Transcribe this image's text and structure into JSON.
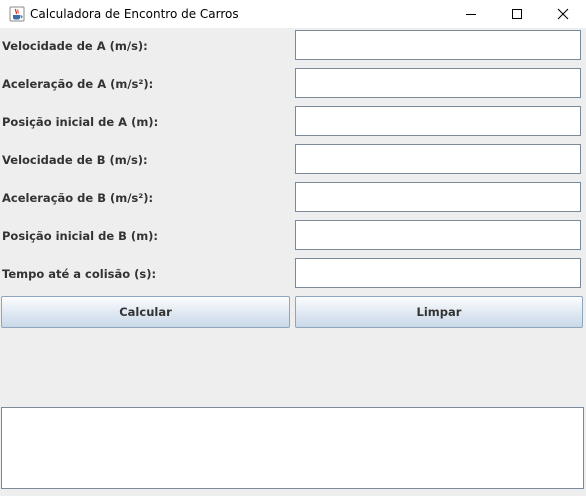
{
  "window": {
    "title": "Calculadora de Encontro de Carros",
    "app_icon": "java-cup-icon",
    "controls": [
      "minimize-icon",
      "maximize-icon",
      "close-icon"
    ]
  },
  "form": {
    "fields": [
      {
        "label": "Velocidade de A (m/s):",
        "value": ""
      },
      {
        "label": "Aceleração de A (m/s²):",
        "value": ""
      },
      {
        "label": "Posição inicial de A (m):",
        "value": ""
      },
      {
        "label": "Velocidade de B (m/s):",
        "value": ""
      },
      {
        "label": "Aceleração de B (m/s²):",
        "value": ""
      },
      {
        "label": "Posição inicial de B (m):",
        "value": ""
      },
      {
        "label": "Tempo até a colisão (s):",
        "value": ""
      }
    ]
  },
  "buttons": {
    "calculate": "Calcular",
    "clear": "Limpar"
  },
  "output": {
    "text": ""
  }
}
